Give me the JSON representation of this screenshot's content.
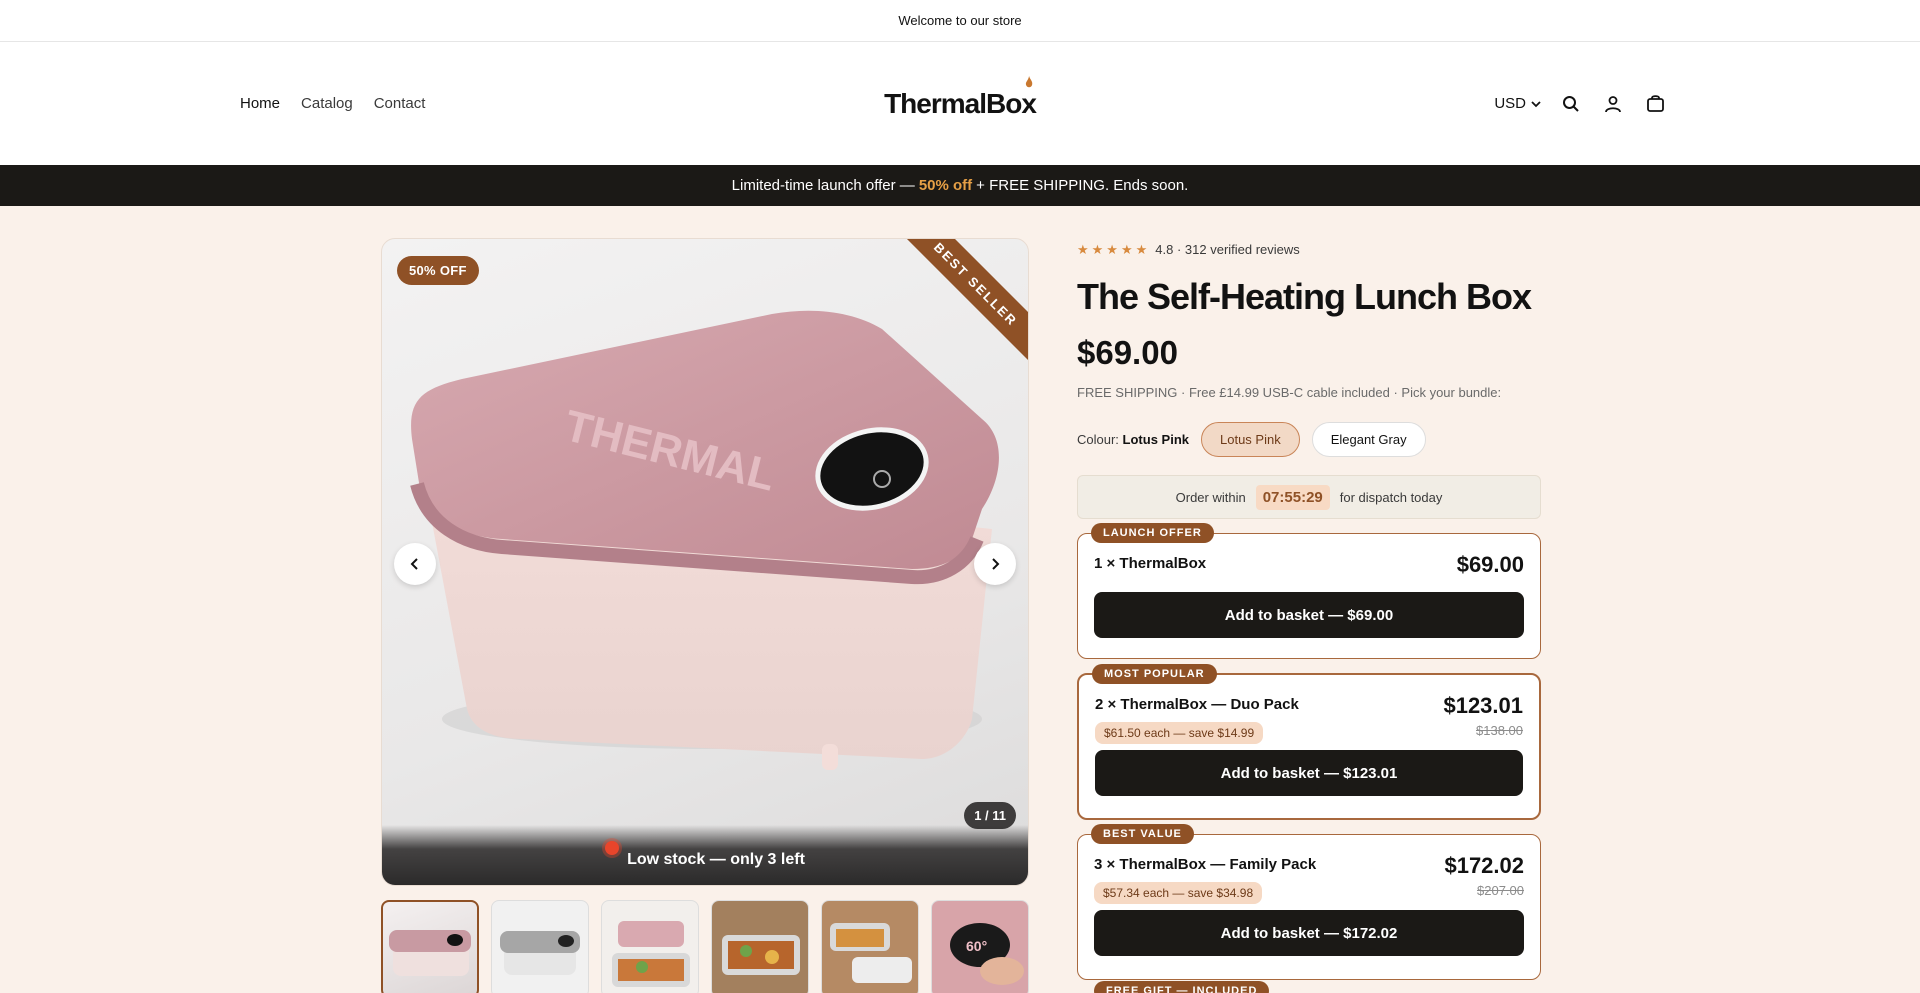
{
  "announcement": {
    "text": "Welcome to our store"
  },
  "header": {
    "nav": [
      {
        "label": "Home"
      },
      {
        "label": "Catalog"
      },
      {
        "label": "Contact"
      }
    ],
    "logo": {
      "part1": "Thermal",
      "part2": "Box"
    },
    "currency": "USD"
  },
  "promo": {
    "pre": "Limited-time launch offer —",
    "accent": "50% off",
    "post": "+ FREE SHIPPING. Ends soon."
  },
  "gallery": {
    "discount_badge": "50% OFF",
    "ribbon": "BEST SELLER",
    "counter": "1 / 11",
    "stock": "Low stock — only 3 left",
    "lid_text": "THERMAL"
  },
  "product": {
    "rating_stars": "★★★★★",
    "rating_text": "4.8 · 312 verified reviews",
    "title": "The Self-Heating Lunch Box",
    "price": "$69.00",
    "shipping": "FREE SHIPPING · Free £14.99 USB-C cable included · Pick your bundle:",
    "colour_label": "Colour:",
    "colour_value": "Lotus Pink",
    "colours": [
      "Lotus Pink",
      "Elegant Gray"
    ],
    "dispatch_pre": "Order within",
    "dispatch_timer": "07:55:29",
    "dispatch_post": "for dispatch today"
  },
  "bundles": [
    {
      "tag": "LAUNCH OFFER",
      "name": "1 × ThermalBox",
      "price": "$69.00",
      "button": "Add to basket — $69.00"
    },
    {
      "tag": "MOST POPULAR",
      "name": "2 × ThermalBox — Duo Pack",
      "save": "$61.50 each — save $14.99",
      "price": "$123.01",
      "was": "$138.00",
      "button": "Add to basket — $123.01"
    },
    {
      "tag": "BEST VALUE",
      "name": "3 × ThermalBox — Family Pack",
      "save": "$57.34 each — save $34.98",
      "price": "$172.02",
      "was": "$207.00",
      "button": "Add to basket — $172.02"
    }
  ],
  "gift_tag": "FREE GIFT — INCLUDED",
  "colors": {
    "accent": "#8f5126",
    "dark": "#1b1916",
    "promo_accent": "#e7a046",
    "page_bg": "#faf1ea"
  }
}
